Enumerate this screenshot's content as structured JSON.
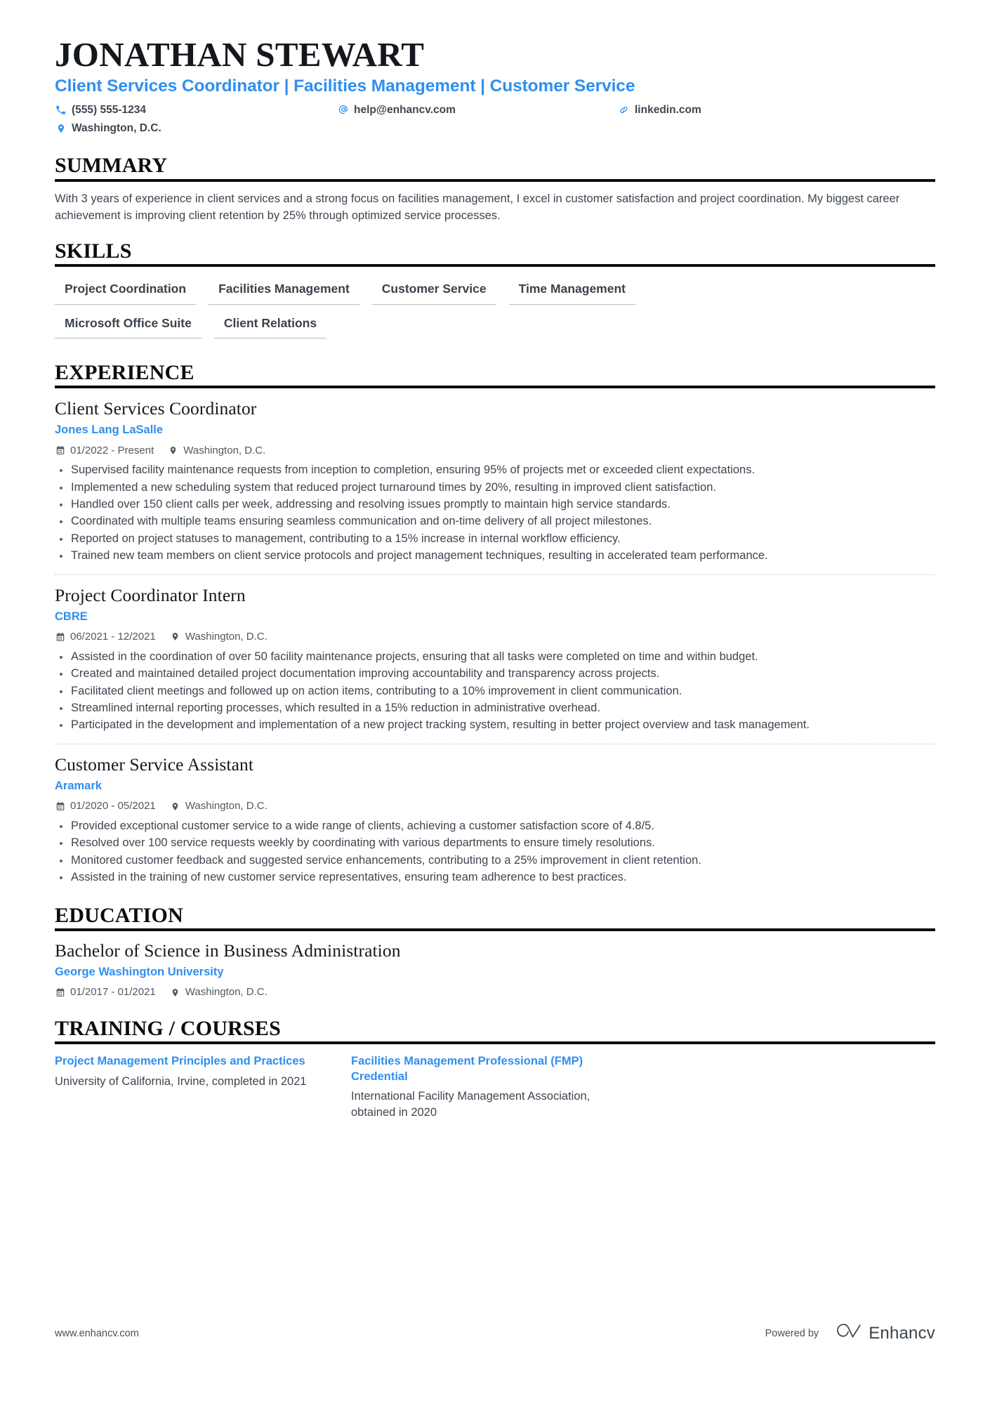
{
  "header": {
    "name": "JONATHAN STEWART",
    "headline": "Client Services Coordinator | Facilities Management | Customer Service",
    "contacts": {
      "phone": "(555) 555-1234",
      "email": "help@enhancv.com",
      "linkedin": "linkedin.com",
      "location": "Washington, D.C."
    }
  },
  "summary": {
    "heading": "SUMMARY",
    "text": "With 3 years of experience in client services and a strong focus on facilities management, I excel in customer satisfaction and project coordination. My biggest career achievement is improving client retention by 25% through optimized service processes."
  },
  "skills": {
    "heading": "SKILLS",
    "items": [
      "Project Coordination",
      "Facilities Management",
      "Customer Service",
      "Time Management",
      "Microsoft Office Suite",
      "Client Relations"
    ]
  },
  "experience": {
    "heading": "EXPERIENCE",
    "entries": [
      {
        "title": "Client Services Coordinator",
        "org": "Jones Lang LaSalle",
        "dates": "01/2022 - Present",
        "location": "Washington, D.C.",
        "bullets": [
          "Supervised facility maintenance requests from inception to completion, ensuring 95% of projects met or exceeded client expectations.",
          "Implemented a new scheduling system that reduced project turnaround times by 20%, resulting in improved client satisfaction.",
          "Handled over 150 client calls per week, addressing and resolving issues promptly to maintain high service standards.",
          "Coordinated with multiple teams ensuring seamless communication and on-time delivery of all project milestones.",
          "Reported on project statuses to management, contributing to a 15% increase in internal workflow efficiency.",
          "Trained new team members on client service protocols and project management techniques, resulting in accelerated team performance."
        ]
      },
      {
        "title": "Project Coordinator Intern",
        "org": "CBRE",
        "dates": "06/2021 - 12/2021",
        "location": "Washington, D.C.",
        "bullets": [
          "Assisted in the coordination of over 50 facility maintenance projects, ensuring that all tasks were completed on time and within budget.",
          "Created and maintained detailed project documentation improving accountability and transparency across projects.",
          "Facilitated client meetings and followed up on action items, contributing to a 10% improvement in client communication.",
          "Streamlined internal reporting processes, which resulted in a 15% reduction in administrative overhead.",
          "Participated in the development and implementation of a new project tracking system, resulting in better project overview and task management."
        ]
      },
      {
        "title": "Customer Service Assistant",
        "org": "Aramark",
        "dates": "01/2020 - 05/2021",
        "location": "Washington, D.C.",
        "bullets": [
          "Provided exceptional customer service to a wide range of clients, achieving a customer satisfaction score of 4.8/5.",
          "Resolved over 100 service requests weekly by coordinating with various departments to ensure timely resolutions.",
          "Monitored customer feedback and suggested service enhancements, contributing to a 25% improvement in client retention.",
          "Assisted in the training of new customer service representatives, ensuring team adherence to best practices."
        ]
      }
    ]
  },
  "education": {
    "heading": "EDUCATION",
    "entries": [
      {
        "degree": "Bachelor of Science in Business Administration",
        "school": "George Washington University",
        "dates": "01/2017 - 01/2021",
        "location": "Washington, D.C."
      }
    ]
  },
  "training": {
    "heading": "TRAINING / COURSES",
    "courses": [
      {
        "title": "Project Management Principles and Practices",
        "desc": "University of California, Irvine, completed in 2021"
      },
      {
        "title": "Facilities Management Professional (FMP) Credential",
        "desc": "International Facility Management Association, obtained in 2020"
      }
    ]
  },
  "footer": {
    "url": "www.enhancv.com",
    "powered_by": "Powered by",
    "brand": "Enhancv"
  },
  "colors": {
    "accent": "#2f8fee",
    "ink": "#14181d",
    "body": "#3e4650",
    "rule": "#0b0d0f",
    "skill_rule": "#b9bec4",
    "divider": "#c6cbd1"
  }
}
